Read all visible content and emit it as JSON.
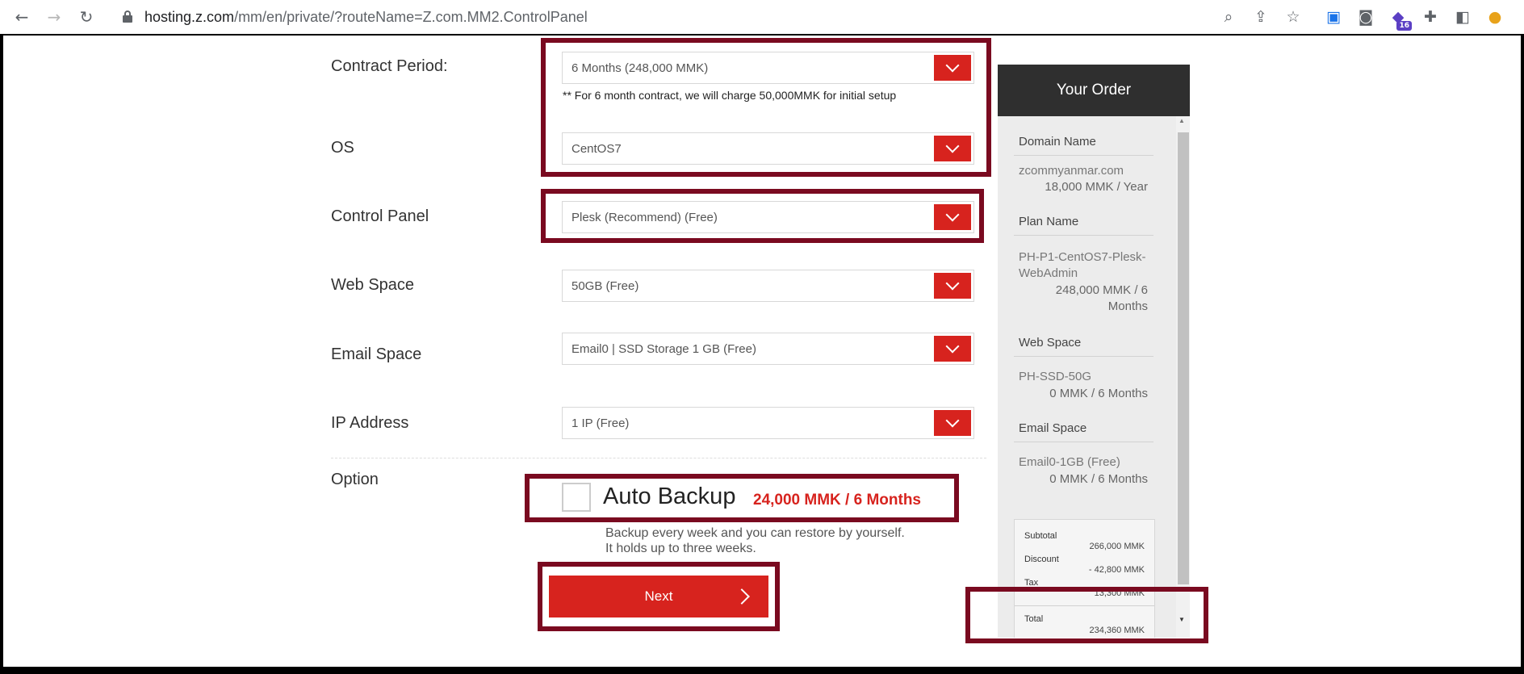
{
  "browser": {
    "url_host": "hosting.z.com",
    "url_path": "/mm/en/private/?routeName=Z.com.MM2.ControlPanel",
    "back_icon": "arrow-left-icon",
    "extension_badge": "16"
  },
  "form": {
    "contract_period": {
      "label": "Contract Period:",
      "value": "6 Months (248,000 MMK)",
      "note": "** For 6 month contract, we will charge 50,000MMK for initial setup"
    },
    "os": {
      "label": "OS",
      "value": "CentOS7"
    },
    "control_panel": {
      "label": "Control Panel",
      "value": "Plesk (Recommend) (Free)"
    },
    "web_space": {
      "label": "Web Space",
      "value": "50GB (Free)"
    },
    "email_space": {
      "label": "Email Space",
      "value": "Email0 | SSD Storage 1 GB (Free)"
    },
    "ip_address": {
      "label": "IP Address",
      "value": "1 IP (Free)"
    },
    "option": {
      "label": "Option",
      "auto_backup_label": "Auto Backup",
      "auto_backup_price": "24,000 MMK / 6 Months",
      "desc_line1": "Backup every week and you can restore by yourself.",
      "desc_line2": "It holds up to three weeks."
    },
    "next_label": "Next"
  },
  "order": {
    "title": "Your Order",
    "domain_title": "Domain Name",
    "domain_name": "zcommyanmar.com",
    "domain_price": "18,000 MMK / Year",
    "plan_title": "Plan Name",
    "plan_name": "PH-P1-CentOS7-Plesk-WebAdmin",
    "plan_price_line1": "248,000 MMK / 6",
    "plan_price_line2": "Months",
    "web_title": "Web Space",
    "web_name": "PH-SSD-50G",
    "web_price": "0 MMK / 6 Months",
    "email_title": "Email Space",
    "email_name": "Email0-1GB (Free)",
    "email_price": "0 MMK / 6 Months",
    "subtotal_label": "Subtotal",
    "subtotal_value": "266,000 MMK",
    "discount_label": "Discount",
    "discount_value": "- 42,800 MMK",
    "tax_label": "Tax",
    "tax_value": "13,300 MMK",
    "total_label": "Total",
    "total_value": "234,360 MMK"
  },
  "colors": {
    "accent": "#d7231e",
    "highlight": "#7a0a20",
    "order_header": "#2f2f2f"
  }
}
